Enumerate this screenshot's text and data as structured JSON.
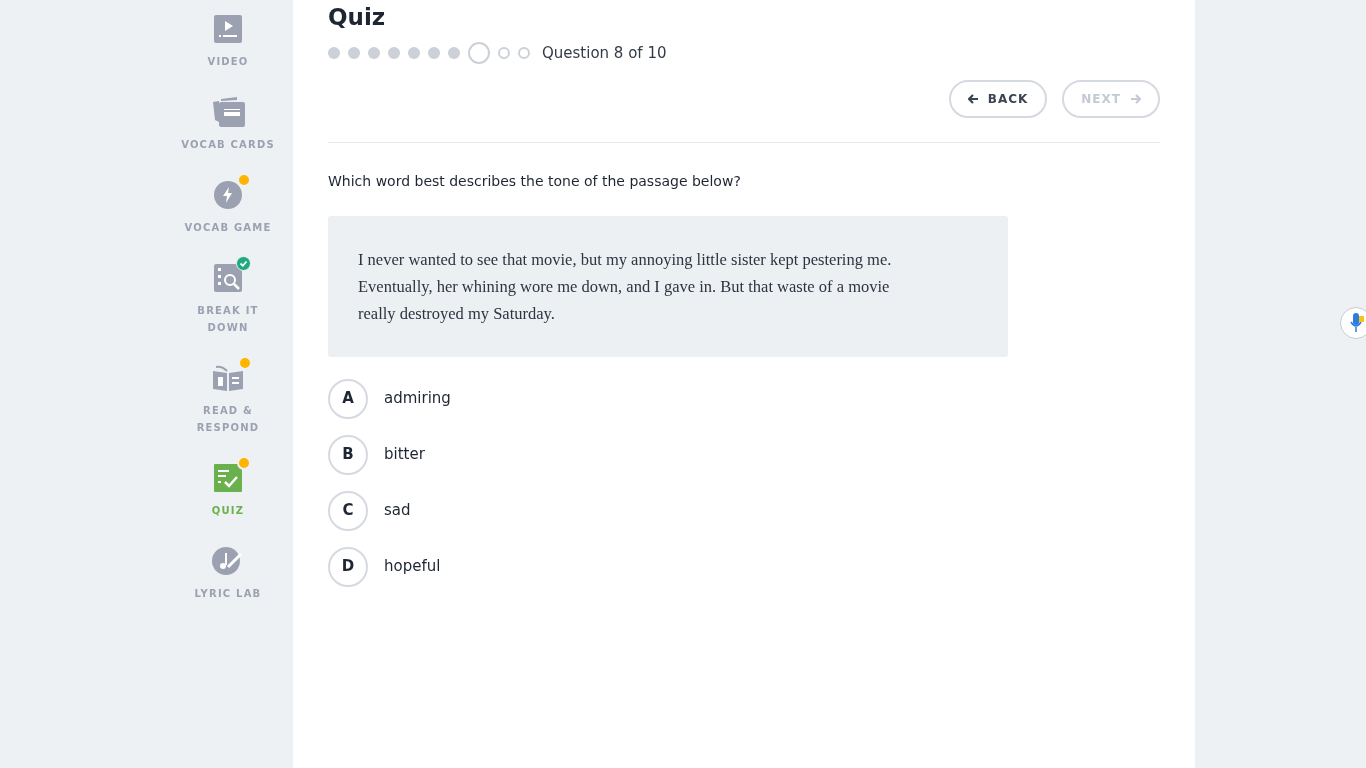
{
  "sidebar": {
    "items": [
      {
        "label": "VIDEO",
        "kind": "video",
        "notification": false,
        "completed": false,
        "selected": false
      },
      {
        "label": "VOCAB CARDS",
        "kind": "cards",
        "notification": false,
        "completed": false,
        "selected": false
      },
      {
        "label": "VOCAB GAME",
        "kind": "bolt",
        "notification": true,
        "completed": false,
        "selected": false
      },
      {
        "label": "BREAK IT DOWN",
        "kind": "search",
        "notification": false,
        "completed": true,
        "selected": false
      },
      {
        "label": "READ & RESPOND",
        "kind": "book",
        "notification": true,
        "completed": false,
        "selected": false
      },
      {
        "label": "QUIZ",
        "kind": "quiz",
        "notification": true,
        "completed": false,
        "selected": true
      },
      {
        "label": "LYRIC LAB",
        "kind": "music",
        "notification": false,
        "completed": false,
        "selected": false
      }
    ]
  },
  "quiz": {
    "title": "Quiz",
    "progress": [
      {
        "kind": "done"
      },
      {
        "kind": "done"
      },
      {
        "kind": "done"
      },
      {
        "kind": "done"
      },
      {
        "kind": "done"
      },
      {
        "kind": "done"
      },
      {
        "kind": "done"
      },
      {
        "kind": "current"
      },
      {
        "kind": "upcoming"
      },
      {
        "kind": "upcoming"
      }
    ],
    "progress_label": "Question 8 of 10",
    "back": {
      "label": "BACK",
      "disabled": false
    },
    "next": {
      "label": "NEXT",
      "disabled": true
    },
    "question": "Which word best describes the tone of the passage below?",
    "passage": "I never wanted to see that movie, but my annoying little sister kept pestering me. Eventually, her whining wore me down, and I gave in. But that waste of a movie really destroyed my Saturday.",
    "options": [
      {
        "letter": "A",
        "text": "admiring",
        "selected": false
      },
      {
        "letter": "B",
        "text": "bitter",
        "selected": false
      },
      {
        "letter": "C",
        "text": "sad",
        "selected": false
      },
      {
        "letter": "D",
        "text": "hopeful",
        "selected": false
      }
    ]
  }
}
